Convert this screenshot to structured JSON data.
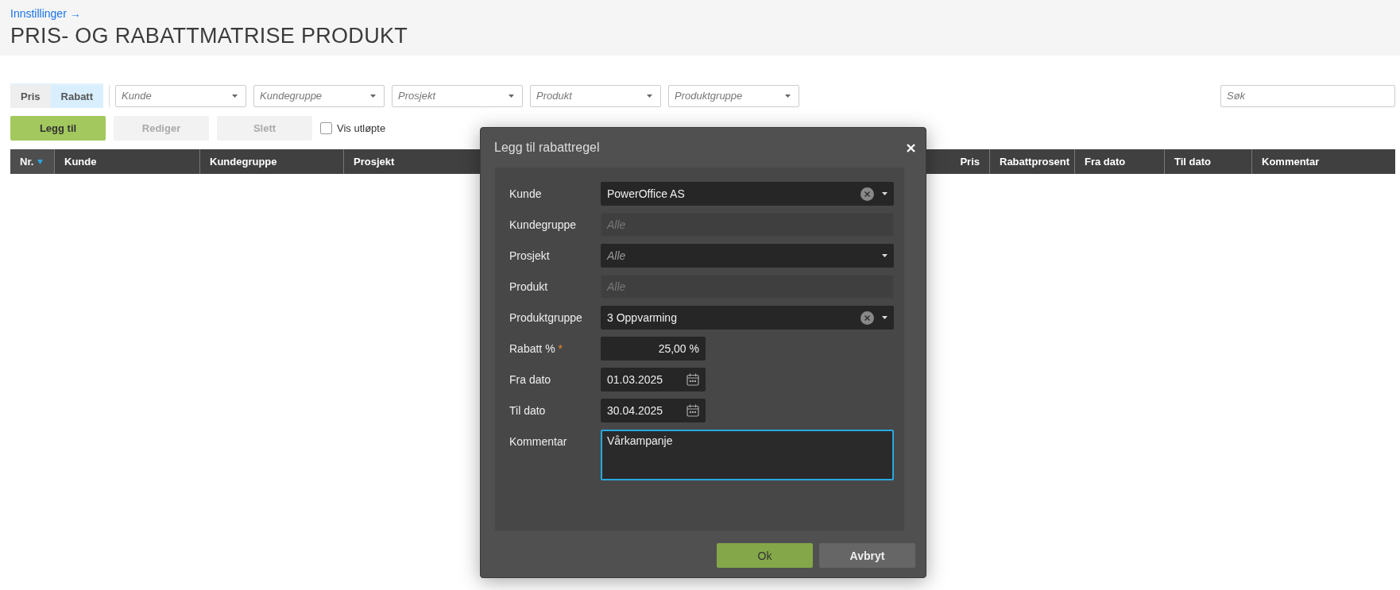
{
  "breadcrumb": {
    "label": "Innstillinger",
    "arrow": "→"
  },
  "title": "PRIS- OG RABATTMATRISE PRODUKT",
  "mode_tabs": [
    {
      "label": "Pris",
      "selected": false
    },
    {
      "label": "Rabatt",
      "selected": true
    }
  ],
  "filters": [
    {
      "placeholder": "Kunde"
    },
    {
      "placeholder": "Kundegruppe"
    },
    {
      "placeholder": "Prosjekt"
    },
    {
      "placeholder": "Produkt"
    },
    {
      "placeholder": "Produktgruppe"
    }
  ],
  "search": {
    "placeholder": "Søk"
  },
  "actions": [
    {
      "label": "Legg til",
      "disabled": false
    },
    {
      "label": "Rediger",
      "disabled": true
    },
    {
      "label": "Slett",
      "disabled": true
    }
  ],
  "show_expired": {
    "label": "Vis utløpte",
    "checked": false
  },
  "table": {
    "columns": [
      {
        "label": "Nr.",
        "sorted": true,
        "numeric": false
      },
      {
        "label": "Kunde",
        "sorted": false,
        "numeric": false
      },
      {
        "label": "Kundegruppe",
        "sorted": false,
        "numeric": false
      },
      {
        "label": "Prosjekt",
        "sorted": false,
        "numeric": false
      },
      {
        "label": "Pris",
        "sorted": false,
        "numeric": true
      },
      {
        "label": "Rabattprosent",
        "sorted": false,
        "numeric": false
      },
      {
        "label": "Fra dato",
        "sorted": false,
        "numeric": false
      },
      {
        "label": "Til dato",
        "sorted": false,
        "numeric": false
      },
      {
        "label": "Kommentar",
        "sorted": false,
        "numeric": false
      }
    ]
  },
  "dialog": {
    "title": "Legg til rabattregel",
    "fields": [
      {
        "label": "Kunde",
        "kind": "select",
        "value": "PowerOffice AS",
        "disabled": false,
        "clearable": true
      },
      {
        "label": "Kundegruppe",
        "kind": "select",
        "placeholder": "Alle",
        "disabled": true
      },
      {
        "label": "Prosjekt",
        "kind": "select",
        "placeholder": "Alle",
        "disabled": false,
        "clearable": false
      },
      {
        "label": "Produkt",
        "kind": "select",
        "placeholder": "Alle",
        "disabled": true
      },
      {
        "label": "Produktgruppe",
        "kind": "select",
        "value": "3 Oppvarming",
        "disabled": false,
        "clearable": true
      },
      {
        "label": "Rabatt %",
        "kind": "number",
        "value": "25,00 %",
        "required_mark": "*"
      },
      {
        "label": "Fra dato",
        "kind": "date",
        "value": "01.03.2025"
      },
      {
        "label": "Til dato",
        "kind": "date",
        "value": "30.04.2025"
      },
      {
        "label": "Kommentar",
        "kind": "textarea",
        "value": "Vårkampanje",
        "focused": true
      }
    ],
    "buttons": [
      {
        "label": "Ok",
        "kind": "primary"
      },
      {
        "label": "Avbryt",
        "kind": "secondary"
      }
    ]
  }
}
